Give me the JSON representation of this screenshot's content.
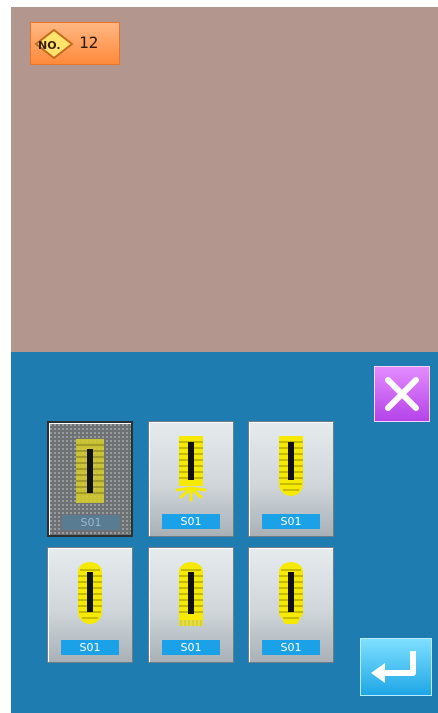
{
  "preview": {
    "background_color": "#b3968d",
    "number_badge": {
      "icon": "no-diamond-icon",
      "icon_text": "NO.",
      "value": "12"
    }
  },
  "panel": {
    "background_color": "#1f7cb0"
  },
  "buttons": {
    "close_icon": "close-icon",
    "enter_icon": "enter-return-icon"
  },
  "patterns": [
    {
      "label": "S01",
      "icon": "buttonhole-square-icon",
      "selected": true
    },
    {
      "label": "S01",
      "icon": "buttonhole-radial-end-icon",
      "selected": false
    },
    {
      "label": "S01",
      "icon": "buttonhole-round-end-icon",
      "selected": false
    },
    {
      "label": "S01",
      "icon": "buttonhole-round-both-icon",
      "selected": false
    },
    {
      "label": "S01",
      "icon": "buttonhole-bartack-icon",
      "selected": false
    },
    {
      "label": "S01",
      "icon": "buttonhole-tapered-end-icon",
      "selected": false
    }
  ]
}
